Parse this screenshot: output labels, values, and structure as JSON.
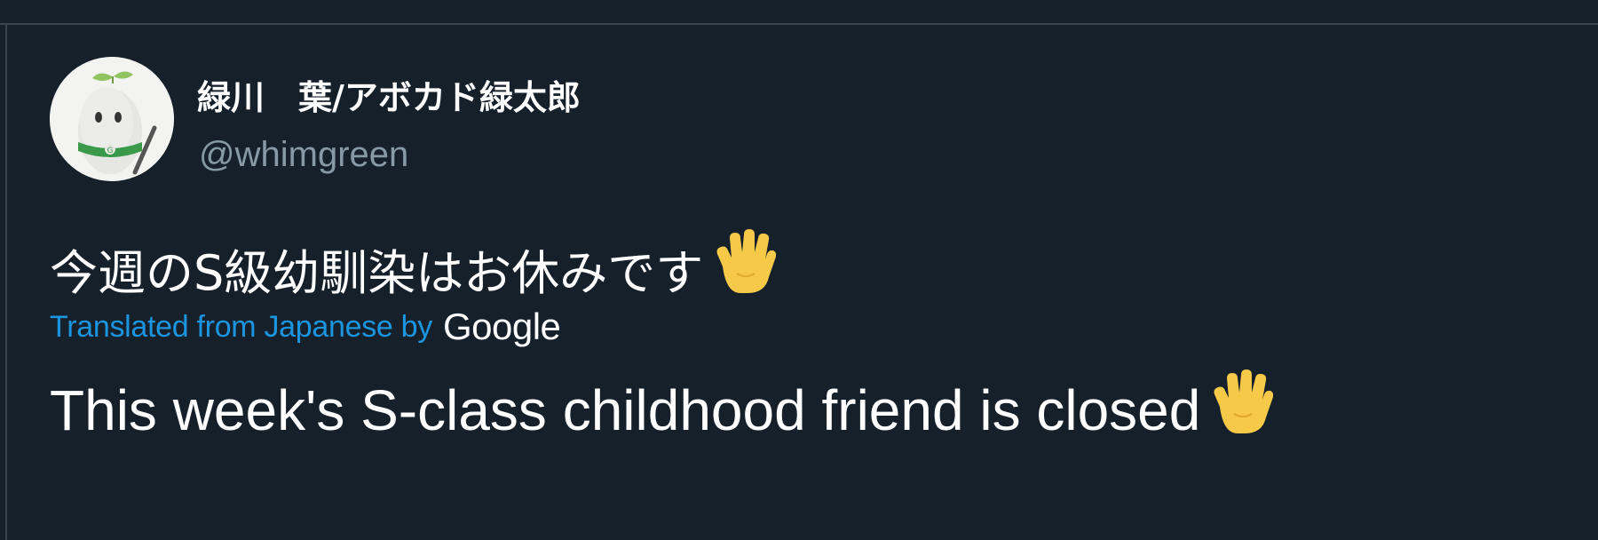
{
  "tweet": {
    "author": {
      "display_name": "緑川　葉/アボカド緑太郎",
      "handle": "@whimgreen",
      "avatar_icon": "avocado-mascot-avatar"
    },
    "original_text": "今週のS級幼馴染はお休みです",
    "original_emoji": "raised-hand-icon",
    "translation": {
      "label": "Translated from Japanese by",
      "provider": "Google",
      "text": "This week's S-class childhood friend is closed",
      "emoji": "raised-hand-icon"
    }
  },
  "colors": {
    "background": "#15202b",
    "divider": "#38444d",
    "primary_text": "#ffffff",
    "secondary_text": "#8899a6",
    "link": "#1b95e0",
    "emoji_hand": "#f7c948"
  }
}
